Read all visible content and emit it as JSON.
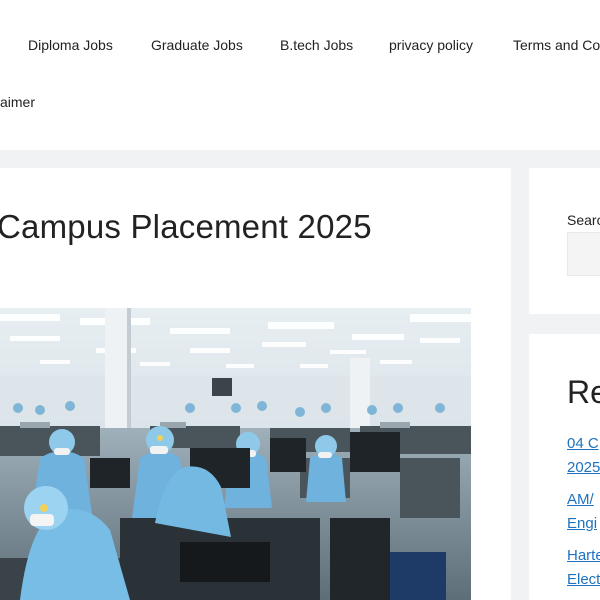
{
  "nav": {
    "items": [
      "Diploma Jobs",
      "Graduate Jobs",
      "B.tech Jobs",
      "privacy policy",
      "Terms and Co"
    ],
    "second_row": "aimer"
  },
  "post": {
    "title": "Campus Placement 2025"
  },
  "sidebar": {
    "search_label": "Searc",
    "recent_heading": "Re",
    "recent_links": [
      [
        "04 C",
        "2025"
      ],
      [
        "AM/",
        "Engi"
      ],
      [
        "Harte",
        "Elect"
      ]
    ]
  },
  "colors": {
    "page_bg": "#f1f2f4",
    "card_bg": "#ffffff",
    "link": "#1e73be",
    "text": "#222222"
  }
}
